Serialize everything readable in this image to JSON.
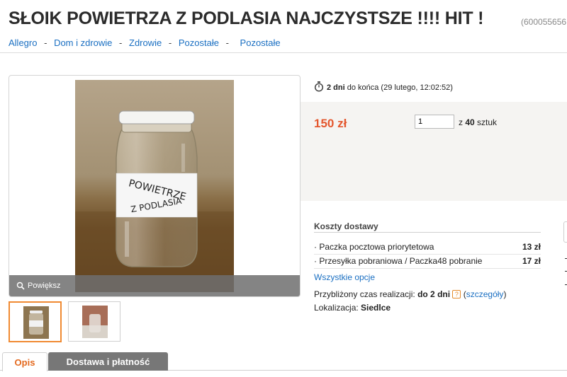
{
  "title": "SŁOIK POWIETRZA Z PODLASIA NAJCZYSTSZE !!!! HIT !",
  "item_id": "(600055656",
  "breadcrumb": [
    "Allegro",
    "Dom i zdrowie",
    "Zdrowie",
    "Pozostałe",
    "Pozostałe"
  ],
  "breadcrumb_sep": "-",
  "gallery": {
    "zoom_label": "Powiększ",
    "jar_label_line1": "POWIETRZE",
    "jar_label_line2": "Z PODLASIA"
  },
  "timer": {
    "bold": "2 dni",
    "text": "do końca (29 lutego, 12:02:52)"
  },
  "price": "150 zł",
  "quantity": {
    "value": "1",
    "of_prefix": "z",
    "available": "40",
    "unit": "sztuk"
  },
  "shipping": {
    "heading": "Koszty dostawy",
    "options": [
      {
        "name": "Paczka pocztowa priorytetowa",
        "price": "13 zł"
      },
      {
        "name": "Przesyłka pobraniowa / Paczka48 pobranie",
        "price": "17 zł"
      }
    ],
    "all_options": "Wszystkie opcje"
  },
  "eta": {
    "label": "Przybliżony czas realizacji:",
    "value": "do 2 dni",
    "details": "szczegóły"
  },
  "location": {
    "label": "Lokalizacja:",
    "value": "Siedlce"
  },
  "tabs": [
    "Opis",
    "Dostawa i płatność"
  ],
  "colors": {
    "price": "#e4572e",
    "link": "#1a6fc2",
    "active_tab": "#e46a1f",
    "inactive_tab_bg": "#777777"
  }
}
